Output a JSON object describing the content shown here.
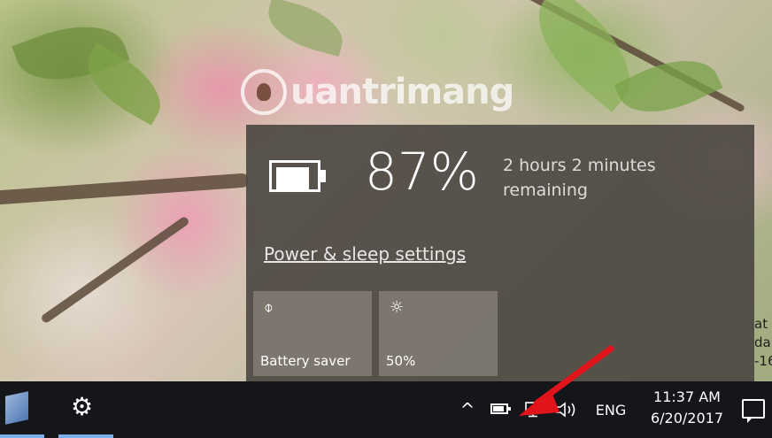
{
  "wallpaper": {
    "watermark_text": "uantrimang"
  },
  "battery_flyout": {
    "percent_text": "87%",
    "charge_level": 0.87,
    "remaining_text": "2 hours 2 minutes remaining",
    "settings_link": "Power & sleep settings",
    "tiles": [
      {
        "label": "Battery saver",
        "icon": "battery-saver-icon",
        "glyph": "⌽"
      },
      {
        "label": "50%",
        "icon": "brightness-icon",
        "glyph": "☼"
      }
    ]
  },
  "taskbar": {
    "settings_glyph": "⚙",
    "tray": {
      "chevron_glyph": "^",
      "volume_glyph": "🕪",
      "language": "ENG"
    },
    "clock": {
      "time": "11:37 AM",
      "date": "6/20/2017"
    }
  },
  "edge_text": [
    "at",
    "da",
    "-16"
  ],
  "colors": {
    "flyout_bg": "#4a4640",
    "taskbar_bg": "#14161a",
    "arrow": "#e0141a"
  }
}
